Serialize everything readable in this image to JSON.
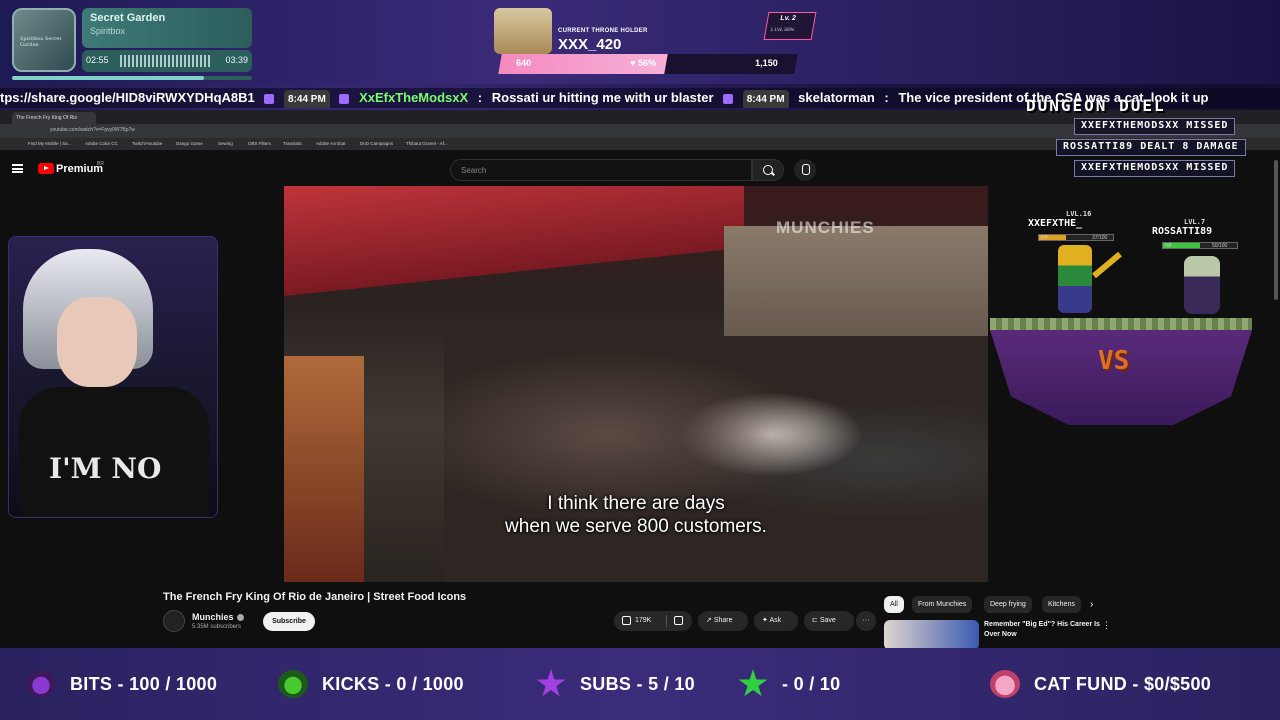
{
  "music": {
    "title": "Secret Garden",
    "artist": "Spiritbox",
    "current_time": "02:55",
    "total_time": "03:39",
    "album_text": "Spiritbox Secret Garden",
    "progress": 0.8
  },
  "throne": {
    "label": "CURRENT THRONE HOLDER",
    "holder": "XXX_420",
    "level": "Lv. 2",
    "level_sub": "1 LVL   56%",
    "min": "640",
    "percent": "56%",
    "max": "1,150",
    "fill": 0.56
  },
  "ticker": {
    "link": "tps://share.google/HID8viRWXYDHqA8B1",
    "time1": "8:44 PM",
    "user1": "XxEfxTheModsxX",
    "msg1": "Rossati ur hitting me with ur blaster",
    "time2": "8:44 PM",
    "user2": "skelatorman",
    "msg2": "The vice president of the CSA was a cat. look it up"
  },
  "browser": {
    "tab_title": "The French Fry King Of Rio",
    "url": "youtube.com/watch?v=Fpvy0W7Bp?w",
    "bookmarks": [
      "Find My Mobile | Sa...",
      "Adobe Color CC",
      "Twitch/Youtube",
      "Dango Game",
      "Sewing",
      "OBS Filters",
      "Translatic",
      "Adobe Acrobat",
      "DnD Campaigns",
      "Thibaut Granet - Af..."
    ]
  },
  "youtube": {
    "brand": "Premium",
    "region": "BR",
    "search_placeholder": "Search",
    "watermark": "MUNCHIES",
    "subtitle_line1": "I think there are days",
    "subtitle_line2": "when we serve 800 customers.",
    "video_title": "The French Fry King Of Rio de Janeiro | Street Food Icons",
    "channel": "Munchies",
    "subscribers": "5.35M subscribers",
    "subscribe": "Subscribe",
    "likes": "179K",
    "share": "Share",
    "ask": "Ask",
    "save": "Save",
    "more": "···",
    "chips": [
      "All",
      "From Munchies",
      "Deep frying",
      "Kitchens"
    ],
    "rec_title": "Remember \"Big Ed\"? His Career Is Over Now"
  },
  "webcam": {
    "shirt_text": "I'M NO"
  },
  "duel": {
    "title": "DUNGEON DUEL",
    "log": [
      "XXEFXTHEMODSXX MISSED",
      "ROSSATTI89 DEALT 8 DAMAGE",
      "XXEFXTHEMODSXX MISSED"
    ],
    "p1_level": "LVL.16",
    "p1_name": "XXEFXTHE_",
    "p1_hp": "37/100",
    "p1_hp_frac": 0.37,
    "p2_level": "LVL.7",
    "p2_name": "ROSSATTI89",
    "p2_hp": "50/100",
    "p2_hp_frac": 0.5,
    "hp_label": "HP",
    "vs": "VS"
  },
  "goals": {
    "bits": "BITS - 100 / 1000",
    "kicks": "KICKS - 0 / 1000",
    "subs": "SUBS - 5 / 10",
    "stars": "- 0 / 10",
    "cat": "CAT FUND - $0/$500"
  },
  "colors": {
    "accent_green": "#79ff6a",
    "youtube_red": "#ff0000",
    "throne_pink": "#f58ac0",
    "vs_orange": "#e07020"
  }
}
